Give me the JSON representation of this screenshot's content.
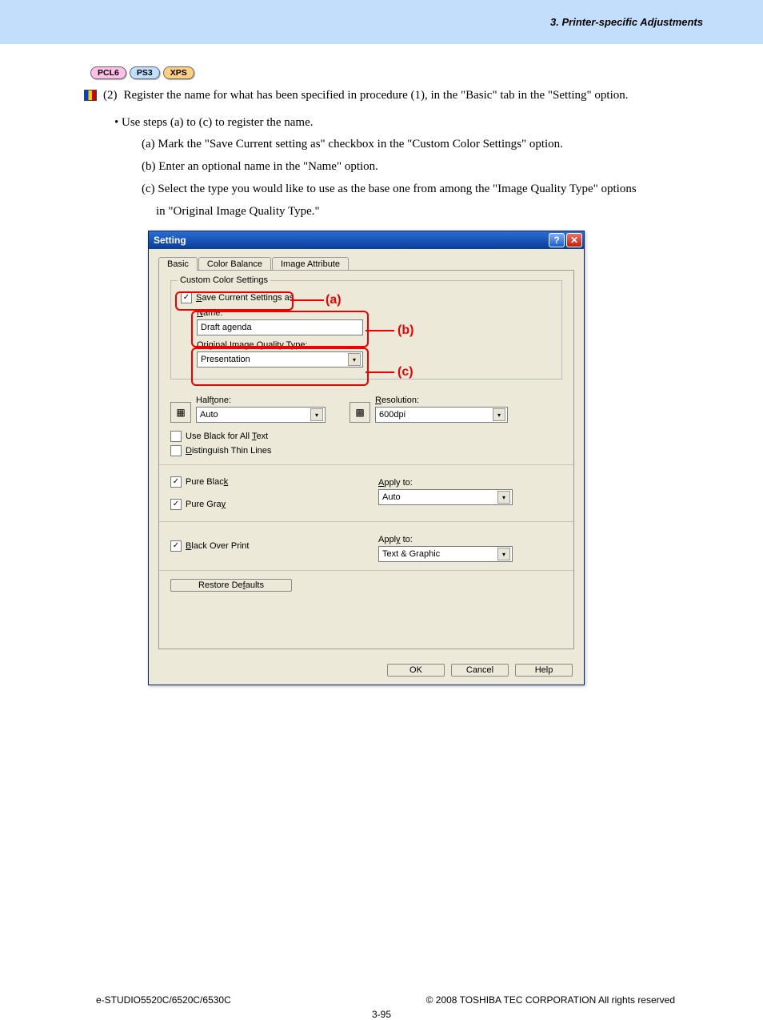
{
  "header": {
    "section": "3. Printer-specific Adjustments"
  },
  "pills": {
    "pcl6": "PCL6",
    "ps3": "PS3",
    "xps": "XPS"
  },
  "proc": {
    "num": "(2)",
    "text": "Register the name for what has been specified in procedure (1), in the \"Basic\" tab in the \"Setting\" option.",
    "use_steps": "• Use steps (a) to (c) to register the name.",
    "a": "(a) Mark the \"Save Current setting as\" checkbox in the \"Custom Color Settings\" option.",
    "b": "(b) Enter an optional name in the \"Name\" option.",
    "c": "(c) Select the type you would like to use as the base one from among the \"Image Quality Type\" options",
    "c2": "in \"Original Image Quality Type.\""
  },
  "dialog": {
    "title": "Setting",
    "tabs": {
      "basic": "Basic",
      "color_balance": "Color Balance",
      "image_attribute": "Image Attribute"
    },
    "fieldset_legend": "Custom Color Settings",
    "save_as": "Save Current Settings as",
    "name_lbl": "Name:",
    "name_val": "Draft agenda",
    "orig_lbl": "Original Image Quality Type:",
    "orig_val": "Presentation",
    "halftone_lbl": "Halftone:",
    "halftone_val": "Auto",
    "resolution_lbl": "Resolution:",
    "resolution_val": "600dpi",
    "use_black": "Use Black for All Text",
    "distinguish": "Distinguish Thin Lines",
    "pure_black": "Pure Black",
    "pure_gray": "Pure Gray",
    "apply_to": "Apply to:",
    "apply_val_1": "Auto",
    "black_overprint": "Black Over Print",
    "apply_val_2": "Text & Graphic",
    "restore": "Restore Defaults",
    "ok": "OK",
    "cancel": "Cancel",
    "help": "Help"
  },
  "callouts": {
    "a": "(a)",
    "b": "(b)",
    "c": "(c)"
  },
  "footer": {
    "left": "e-STUDIO5520C/6520C/6530C",
    "right": "© 2008 TOSHIBA TEC CORPORATION All rights reserved",
    "center": "3-95"
  }
}
